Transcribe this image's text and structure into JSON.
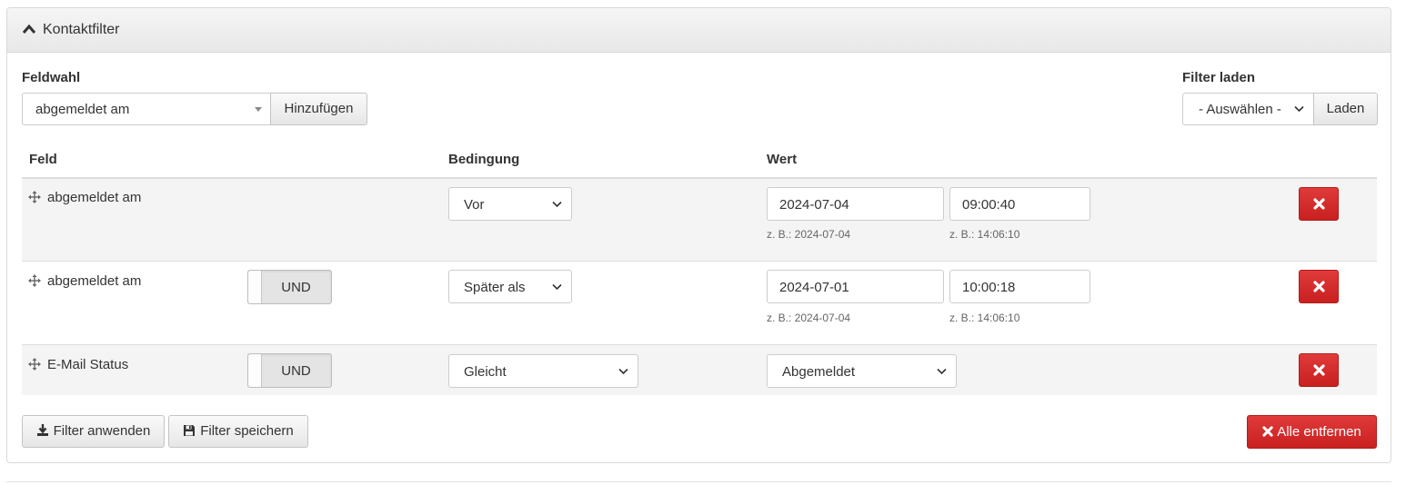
{
  "panel": {
    "title": "Kontaktfilter"
  },
  "field_select": {
    "label": "Feldwahl",
    "value": "abgemeldet am",
    "add_button": "Hinzufügen"
  },
  "load_filter": {
    "label": "Filter laden",
    "value": "- Auswählen -",
    "button": "Laden"
  },
  "table": {
    "headers": {
      "field": "Feld",
      "condition": "Bedingung",
      "value": "Wert"
    },
    "rows": [
      {
        "field": "abgemeldet am",
        "operator": "",
        "condition": "Vor",
        "date": "2024-07-04",
        "time": "09:00:40",
        "date_hint": "z. B.: 2024-07-04",
        "time_hint": "z. B.: 14:06:10"
      },
      {
        "field": "abgemeldet am",
        "operator": "UND",
        "condition": "Später als",
        "date": "2024-07-01",
        "time": "10:00:18",
        "date_hint": "z. B.: 2024-07-04",
        "time_hint": "z. B.: 14:06:10"
      },
      {
        "field": "E-Mail Status",
        "operator": "UND",
        "condition": "Gleicht",
        "value_select": "Abgemeldet"
      }
    ]
  },
  "footer": {
    "apply": "Filter anwenden",
    "save": "Filter speichern",
    "remove_all": "Alle entfernen"
  },
  "colors": {
    "danger": "#d32a2a",
    "row_alt": "#f4f4f4",
    "header_bg": "#eeeeee"
  },
  "icons": {
    "collapse": "chevron-up-icon",
    "move": "move-icon",
    "delete": "times-icon",
    "apply": "download-icon",
    "save": "floppy-icon"
  }
}
